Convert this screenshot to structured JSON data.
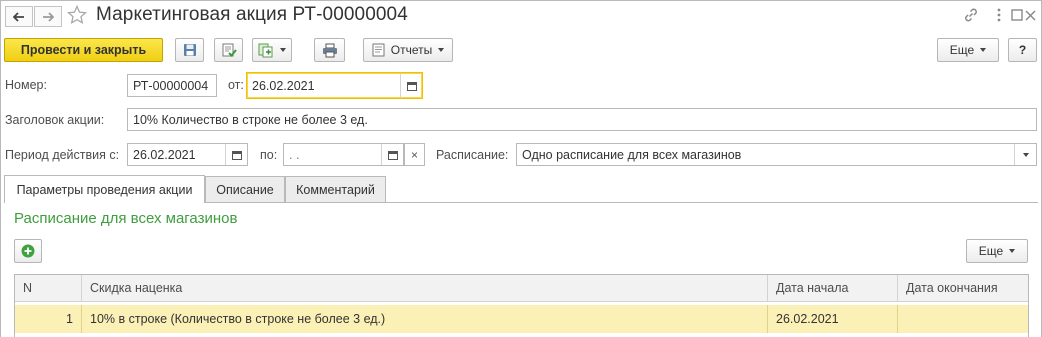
{
  "header": {
    "title": "Маркетинговая акция РТ-00000004",
    "back_icon": "arrow-left-icon",
    "forward_icon": "arrow-right-icon",
    "favorite_icon": "star-icon"
  },
  "window_controls": {
    "link_icon": "link-icon",
    "menu_icon": "more-vertical-icon",
    "maximize_icon": "maximize-icon",
    "close_icon": "close-icon"
  },
  "toolbar": {
    "post_close_label": "Провести и закрыть",
    "reports_label": "Отчеты",
    "more_label": "Еще",
    "help_label": "?"
  },
  "form": {
    "number_label": "Номер:",
    "number_value": "РТ-00000004",
    "date_label": "от:",
    "date_value": "26.02.2021",
    "heading_label": "Заголовок акции:",
    "heading_value": "10% Количество в строке не более 3 ед.",
    "period_label": "Период действия с:",
    "period_from": "26.02.2021",
    "period_to_label": "по:",
    "period_to": " .  .",
    "schedule_label": "Расписание:",
    "schedule_value": "Одно расписание для всех магазинов"
  },
  "tabs": [
    {
      "label": "Параметры проведения акции"
    },
    {
      "label": "Описание"
    },
    {
      "label": "Комментарий"
    }
  ],
  "section": {
    "title": "Расписание для всех магазинов",
    "more_label": "Еще"
  },
  "table": {
    "columns": [
      "N",
      "Скидка наценка",
      "Дата начала",
      "Дата окончания"
    ],
    "rows": [
      {
        "n": "1",
        "discount": "10% в строке (Количество в строке не более 3 ед.)",
        "start": "26.02.2021",
        "end": ""
      }
    ]
  },
  "colors": {
    "primary_button": "#f5d82e",
    "section_title": "#3f9e3f",
    "selected_row": "#fbf1b6",
    "focus_border": "#f0c200"
  }
}
